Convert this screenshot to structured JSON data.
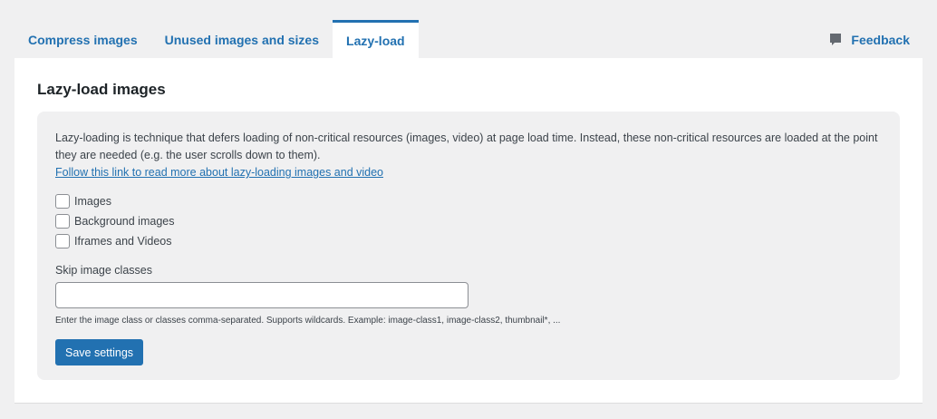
{
  "tabs": [
    {
      "label": "Compress images",
      "active": false
    },
    {
      "label": "Unused images and sizes",
      "active": false
    },
    {
      "label": "Lazy-load",
      "active": true
    }
  ],
  "feedback": {
    "label": "Feedback",
    "icon": "speech-bubble-icon"
  },
  "panel": {
    "title": "Lazy-load images",
    "description": "Lazy-loading is technique that defers loading of non-critical resources (images, video) at page load time. Instead, these non-critical resources are loaded at the point they are needed (e.g. the user scrolls down to them).",
    "link_text": "Follow this link to read more about lazy-loading images and video",
    "options": [
      {
        "label": "Images",
        "checked": false
      },
      {
        "label": "Background images",
        "checked": false
      },
      {
        "label": "Iframes and Videos",
        "checked": false
      }
    ],
    "skip_classes": {
      "label": "Skip image classes",
      "value": "",
      "hint": "Enter the image class or classes comma-separated. Supports wildcards. Example: image-class1, image-class2, thumbnail*, ..."
    },
    "save_label": "Save settings"
  },
  "colors": {
    "accent": "#2271b1",
    "page_bg": "#f0f0f1",
    "panel_bg": "#ffffff",
    "card_bg": "#f0f0f1",
    "text": "#3c434a"
  }
}
